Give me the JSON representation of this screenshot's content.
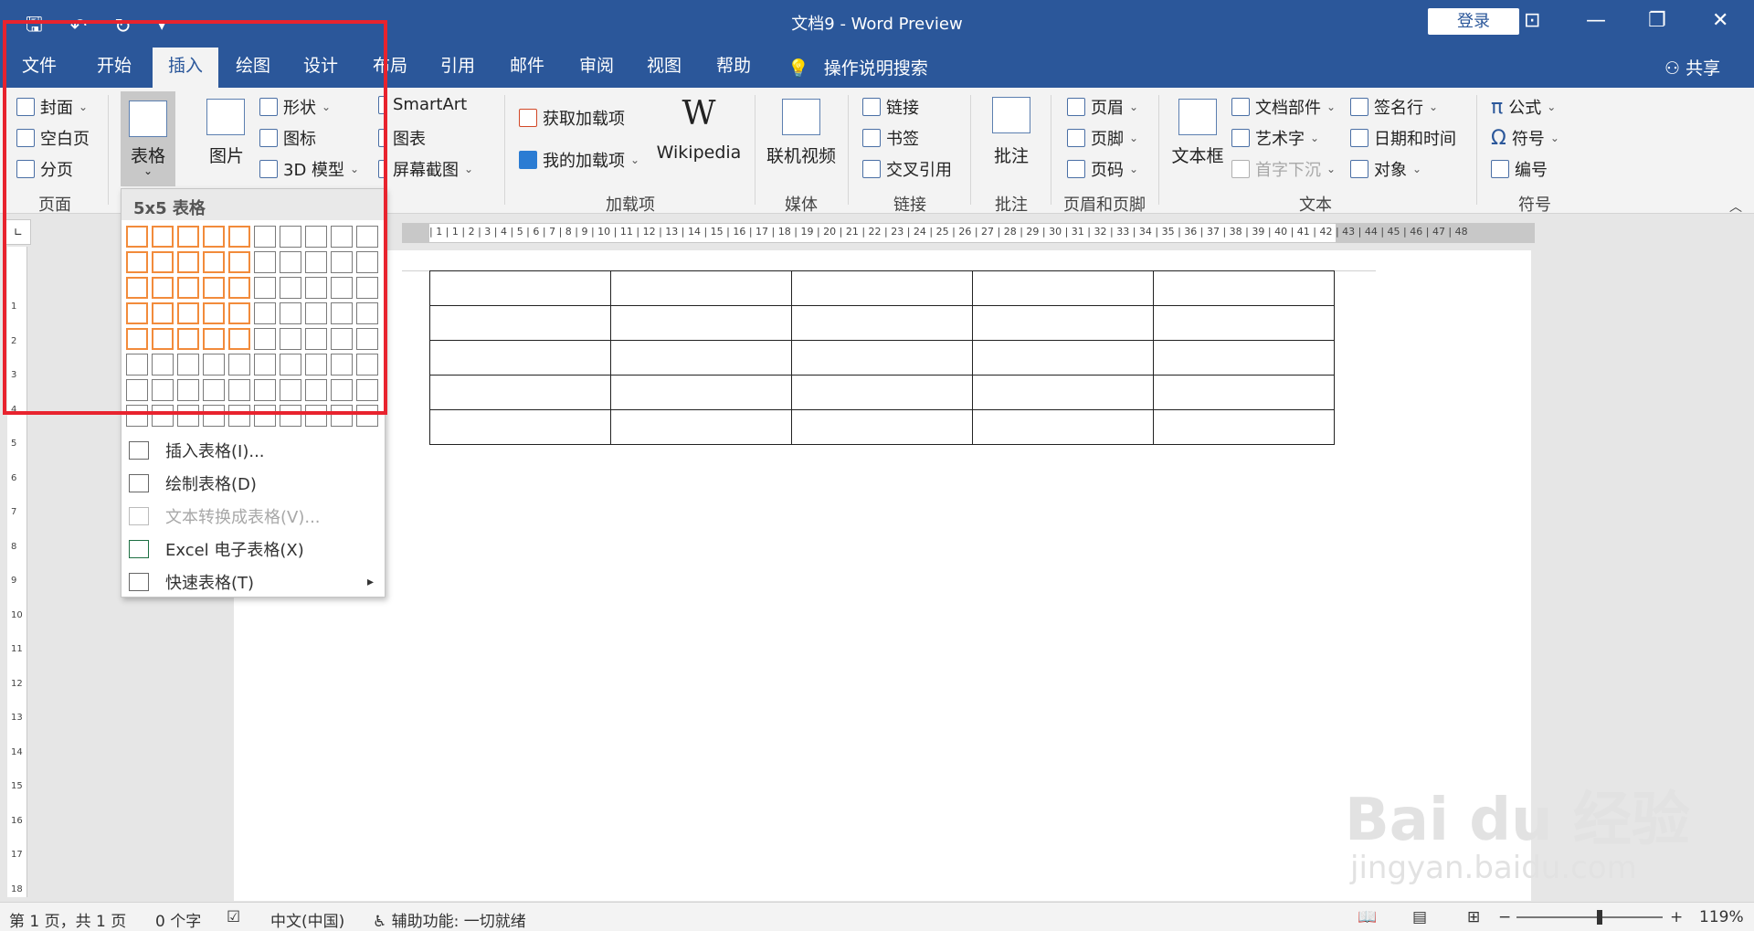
{
  "window": {
    "title": "文档9  -  Word Preview",
    "login": "登录",
    "min_icon": "minimize-icon",
    "max_icon": "restore-icon",
    "close_icon": "close-icon"
  },
  "tabs": [
    {
      "label": "文件"
    },
    {
      "label": "开始"
    },
    {
      "label": "插入",
      "active": true
    },
    {
      "label": "绘图"
    },
    {
      "label": "设计"
    },
    {
      "label": "布局"
    },
    {
      "label": "引用"
    },
    {
      "label": "邮件"
    },
    {
      "label": "审阅"
    },
    {
      "label": "视图"
    },
    {
      "label": "帮助"
    }
  ],
  "search": "操作说明搜索",
  "share": "共享",
  "ribbon": {
    "page": {
      "cover": "封面",
      "blank": "空白页",
      "break": "分页",
      "label": "页面"
    },
    "table": {
      "label": "表格"
    },
    "illustrations": {
      "picture": "图片",
      "shapes": "形状",
      "icons": "图标",
      "model3d": "3D 模型",
      "smartart": "SmartArt",
      "chart": "图表",
      "screenshot": "屏幕截图"
    },
    "addins": {
      "get": "获取加载项",
      "mine": "我的加载项",
      "wikipedia": "Wikipedia",
      "label": "加载项"
    },
    "media": {
      "video": "联机视频",
      "label": "媒体"
    },
    "links": {
      "link": "链接",
      "bookmark": "书签",
      "crossref": "交叉引用",
      "label": "链接"
    },
    "comments": {
      "comment": "批注",
      "label": "批注"
    },
    "headerfooter": {
      "header": "页眉",
      "footer": "页脚",
      "pagenum": "页码",
      "label": "页眉和页脚"
    },
    "text": {
      "textbox": "文本框",
      "parts": "文档部件",
      "wordart": "艺术字",
      "dropcap": "首字下沉",
      "sigline": "签名行",
      "datetime": "日期和时间",
      "object": "对象",
      "label": "文本"
    },
    "symbols": {
      "equation": "公式",
      "symbol": "符号",
      "number": "编号",
      "label": "符号"
    }
  },
  "dropdown": {
    "header": "5x5 表格",
    "grid_cols": 10,
    "grid_rows": 8,
    "selected_cols": 5,
    "selected_rows": 5,
    "items": [
      {
        "label": "插入表格(I)...",
        "disabled": false
      },
      {
        "label": "绘制表格(D)",
        "disabled": false
      },
      {
        "label": "文本转换成表格(V)...",
        "disabled": true
      },
      {
        "label": "Excel 电子表格(X)",
        "disabled": false
      },
      {
        "label": "快速表格(T)",
        "disabled": false,
        "submenu": true
      }
    ]
  },
  "document": {
    "table_rows": 5,
    "table_cols": 5
  },
  "ruler": "|  1  |  1  |  2  |  3  |  4  |  5  |  6  |  7  |  8  |  9  | 10 | 11 | 12 | 13 | 14 | 15 | 16 | 17 | 18 | 19 | 20 | 21 | 22 | 23 | 24 | 25 | 26 | 27 | 28 | 29 | 30 | 31 | 32 | 33 | 34 | 35 | 36 | 37 | 38 | 39 | 40 | 41 | 42 | 43 | 44 | 45 | 46 | 47 | 48",
  "vruler": [
    "1",
    "2",
    "3",
    "4",
    "5",
    "6",
    "7",
    "8",
    "9",
    "10",
    "11",
    "12",
    "13",
    "14",
    "15",
    "16",
    "17",
    "18"
  ],
  "status": {
    "page": "第 1 页，共 1 页",
    "words": "0 个字",
    "lang": "中文(中国)",
    "access": "辅助功能: 一切就绪",
    "zoom": "119%",
    "zoom_level": 119
  },
  "watermark": {
    "brand": "Bai du 经验",
    "url": "jingyan.baidu.com"
  }
}
